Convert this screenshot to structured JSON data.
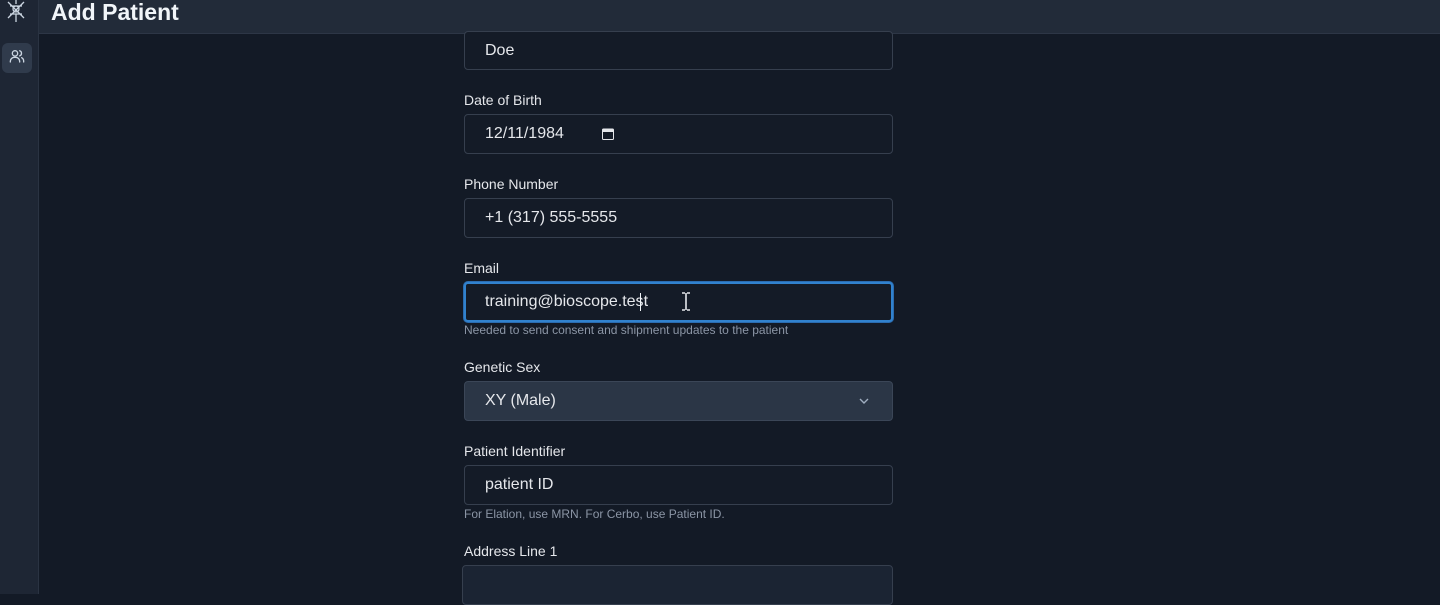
{
  "header": {
    "title": "Add Patient"
  },
  "sidebar": {
    "items": [
      {
        "icon": "users-icon"
      }
    ]
  },
  "form": {
    "last_name_value": "Doe",
    "dob": {
      "label": "Date of Birth",
      "value": "12/11/1984"
    },
    "phone": {
      "label": "Phone Number",
      "value": "+1 (317) 555-5555"
    },
    "email": {
      "label": "Email",
      "value_before_caret": "training@bioscope.tes",
      "value_after_caret": "t",
      "helper": "Needed to send consent and shipment updates to the patient"
    },
    "sex": {
      "label": "Genetic Sex",
      "selected": "XY (Male)"
    },
    "patient_id": {
      "label": "Patient Identifier",
      "value": "patient ID",
      "helper": "For Elation, use MRN. For Cerbo, use Patient ID."
    },
    "address1": {
      "label": "Address Line 1",
      "value": ""
    }
  },
  "colors": {
    "accent": "#3182ce",
    "background": "#131a26",
    "input_bg": "#141b27",
    "select_bg": "#2b3646"
  }
}
